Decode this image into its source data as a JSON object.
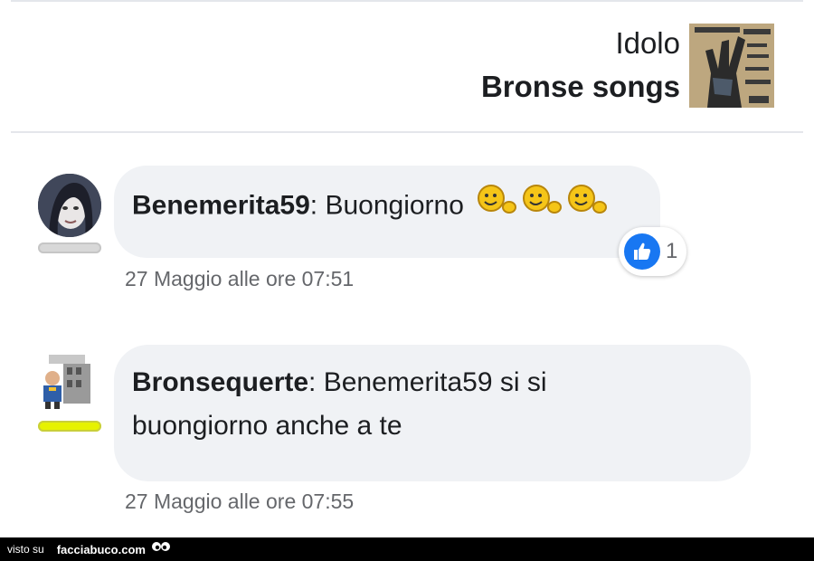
{
  "post": {
    "subtitle": "Idolo",
    "title": "Bronse songs"
  },
  "comments": [
    {
      "author": "Benemerita59",
      "separator": ":",
      "text": " Buongiorno",
      "emoji_count": 3,
      "timestamp": "27 Maggio alle ore 07:51",
      "reactions": {
        "type": "like-icon",
        "count": "1"
      },
      "status_color": "#d8d8d8"
    },
    {
      "author": "Bronsequerte",
      "separator": ":",
      "text_line1": " Benemerita59 si si",
      "text_line2": "buongiorno anche a te",
      "timestamp": "27 Maggio alle ore 07:55",
      "status_color": "#e6f200"
    }
  ],
  "footer": {
    "visto": "visto su",
    "brand": "facciabuco.com"
  },
  "colors": {
    "like_blue": "#1877f2",
    "bubble_bg": "#f0f2f5",
    "meta_text": "#65676b"
  }
}
